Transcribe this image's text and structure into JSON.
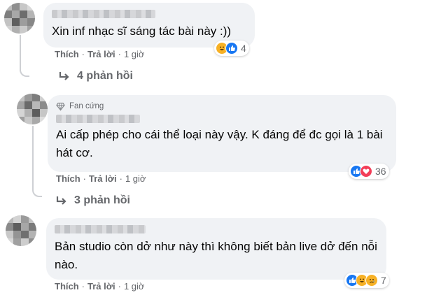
{
  "comments": [
    {
      "text": "Xin inf nhạc sĩ sáng tác bài này :))",
      "badge": "",
      "actions": {
        "like": "Thích",
        "reply": "Trả lời",
        "time": "1 giờ"
      },
      "reactions": {
        "icons": [
          "haha-icon",
          "like-icon"
        ],
        "count": "4"
      },
      "replies": "4 phản hồi"
    },
    {
      "text": "Ai cấp phép cho cái thể loại này vậy. K đáng để đc gọi là 1 bài hát cơ.",
      "badge": "Fan cứng",
      "actions": {
        "like": "Thích",
        "reply": "Trả lời",
        "time": "1 giờ"
      },
      "reactions": {
        "icons": [
          "like-icon",
          "love-icon"
        ],
        "count": "36"
      },
      "replies": "3 phản hồi"
    },
    {
      "text": "Bản studio còn dở như này thì không biết bản live dở đến nỗi nào.",
      "badge": "",
      "actions": {
        "like": "Thích",
        "reply": "Trả lời",
        "time": "1 giờ"
      },
      "reactions": {
        "icons": [
          "like-icon",
          "haha-icon",
          "sad-icon"
        ],
        "count": "7"
      },
      "replies": ""
    }
  ],
  "separator": "·",
  "colors": {
    "bubble": "#f0f2f5",
    "secondary_text": "#65676b",
    "like": "#1877f2",
    "love": "#f33e58",
    "haha": "#f7b125"
  }
}
